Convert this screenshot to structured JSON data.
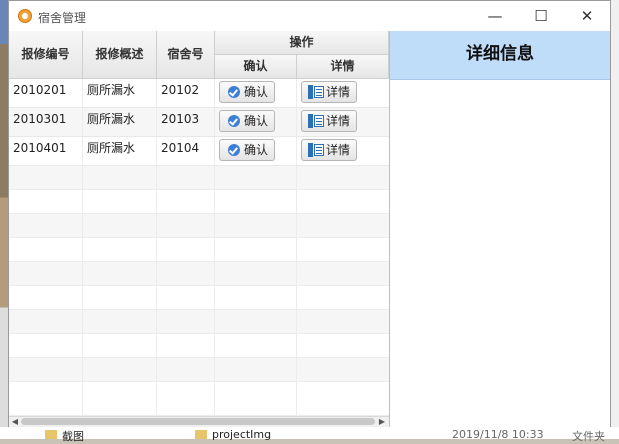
{
  "window": {
    "title": "宿舍管理"
  },
  "table": {
    "headers": {
      "repair_no": "报修编号",
      "description": "报修概述",
      "dorm_no": "宿舍号",
      "operation": "操作",
      "confirm": "确认",
      "detail": "详情"
    },
    "rows": [
      {
        "repair_no": "2010201",
        "description": "厕所漏水",
        "dorm_no": "20102",
        "confirm_label": "确认",
        "detail_label": "详情"
      },
      {
        "repair_no": "2010301",
        "description": "厕所漏水",
        "dorm_no": "20103",
        "confirm_label": "确认",
        "detail_label": "详情"
      },
      {
        "repair_no": "2010401",
        "description": "厕所漏水",
        "dorm_no": "20104",
        "confirm_label": "确认",
        "detail_label": "详情"
      }
    ]
  },
  "detail_panel": {
    "title": "详细信息"
  },
  "background": {
    "item1": "截图",
    "item2": "projectImg",
    "item3": "2019/11/8 10:33",
    "item4": "文件夹"
  },
  "colors": {
    "detail_header_bg": "#bfdcf8",
    "confirm_icon": "#3d7fd6",
    "detail_icon": "#2a6fb8"
  }
}
